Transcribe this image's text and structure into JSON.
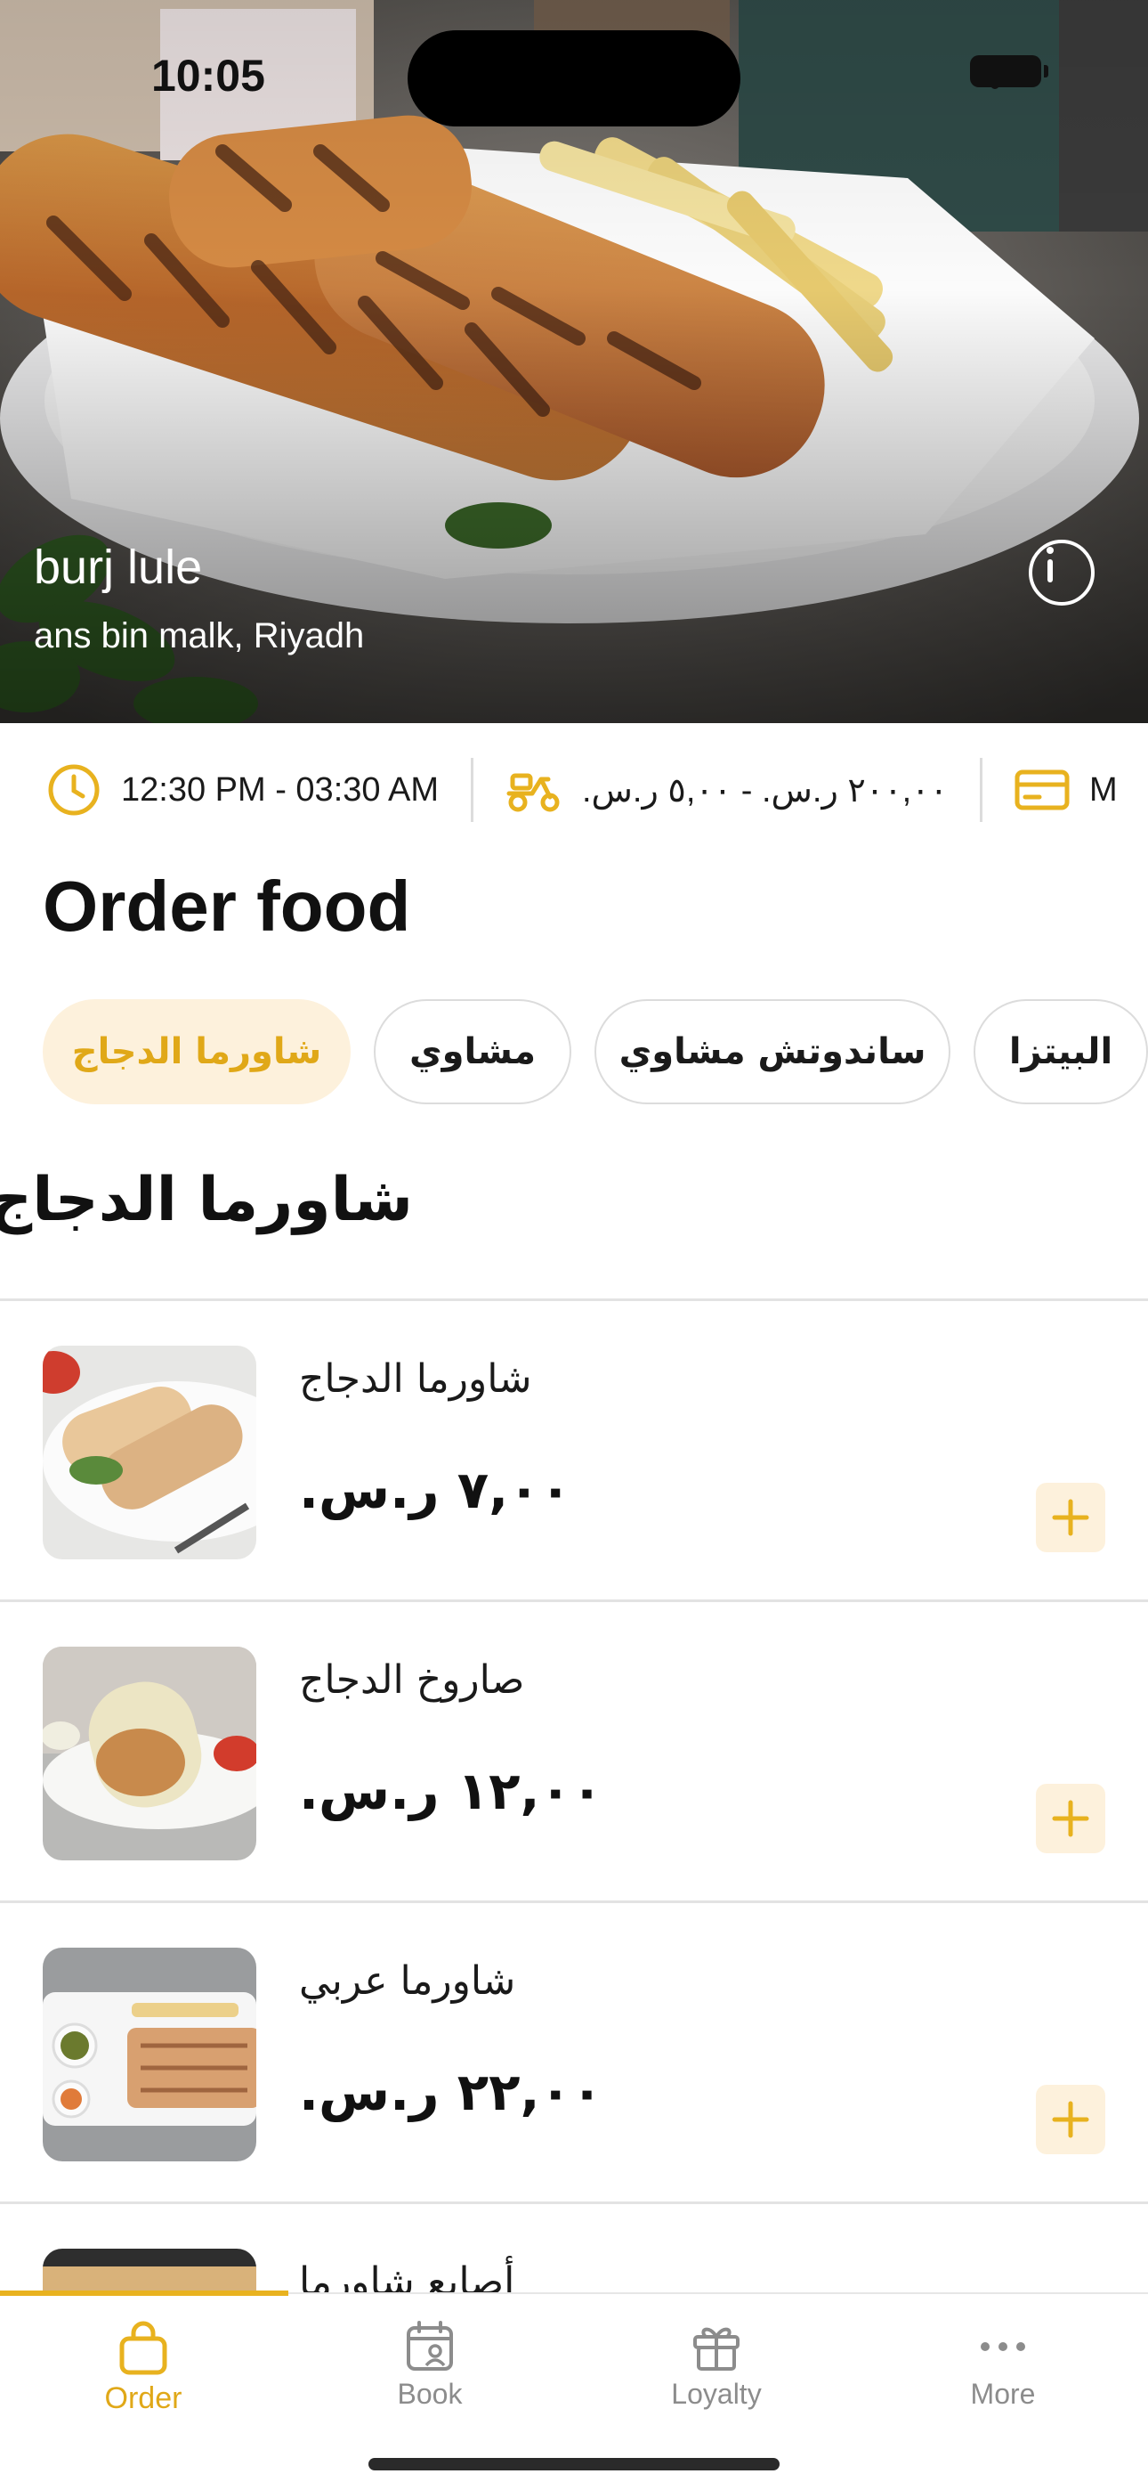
{
  "status_bar": {
    "time": "10:05"
  },
  "restaurant": {
    "name": "burj lule",
    "address": "ans bin malk, Riyadh"
  },
  "info_strip": {
    "hours": "12:30 PM - 03:30 AM",
    "delivery_fee": "٢٠٠,٠٠ ر.س. - ٥,٠٠ ر.س.",
    "payment_partial": "M"
  },
  "page_title": "Order food",
  "categories": [
    {
      "label": "شاورما الدجاج",
      "active": true
    },
    {
      "label": "مشاوي",
      "active": false
    },
    {
      "label": "ساندوتش مشاوي",
      "active": false
    },
    {
      "label": "البيتزا",
      "active": false
    }
  ],
  "section_title": "شاورما الدجاج",
  "menu_items": [
    {
      "name": "شاورما الدجاج",
      "price": "٧,٠٠ ر.س."
    },
    {
      "name": "صاروخ الدجاج",
      "price": "١٢,٠٠ ر.س."
    },
    {
      "name": "شاورما عربي",
      "price": "٢٢,٠٠ ر.س."
    },
    {
      "name": "أصابع شاورما",
      "price": ""
    }
  ],
  "tabbar": {
    "order": "Order",
    "book": "Book",
    "loyalty": "Loyalty",
    "more": "More"
  },
  "colors": {
    "accent": "#e8b21f",
    "accent_soft": "#fdf1dc",
    "divider": "#e3e3e3"
  },
  "icons": [
    "clock-icon",
    "scooter-icon",
    "card-icon",
    "info-icon",
    "plus-icon",
    "bag-icon",
    "calendar-icon",
    "gift-icon",
    "more-dots-icon",
    "wifi-icon",
    "battery-icon"
  ]
}
